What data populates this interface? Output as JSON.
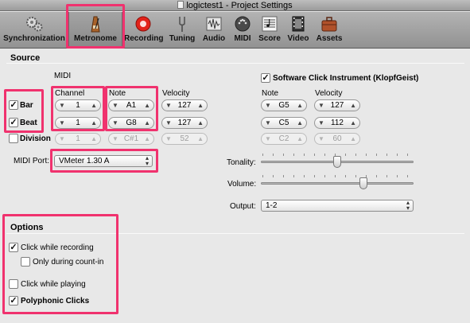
{
  "window": {
    "title": "logictest1 - Project Settings"
  },
  "toolbar": {
    "items": [
      {
        "label": "Synchronization",
        "icon": "gears-icon"
      },
      {
        "label": "Metronome",
        "icon": "metronome-icon",
        "selected": true
      },
      {
        "label": "Recording",
        "icon": "record-icon"
      },
      {
        "label": "Tuning",
        "icon": "tuning-fork-icon"
      },
      {
        "label": "Audio",
        "icon": "audio-icon"
      },
      {
        "label": "MIDI",
        "icon": "midi-icon"
      },
      {
        "label": "Score",
        "icon": "score-icon"
      },
      {
        "label": "Video",
        "icon": "video-icon"
      },
      {
        "label": "Assets",
        "icon": "assets-icon"
      }
    ]
  },
  "source": {
    "title": "Source",
    "midi_heading": "MIDI",
    "headers": {
      "channel": "Channel",
      "note": "Note",
      "velocity": "Velocity"
    },
    "rows": [
      {
        "label": "Bar",
        "checked": true,
        "channel": "1",
        "note": "A1",
        "velocity": "127",
        "sw_note": "G5",
        "sw_velocity": "127"
      },
      {
        "label": "Beat",
        "checked": true,
        "channel": "1",
        "note": "G8",
        "velocity": "127",
        "sw_note": "C5",
        "sw_velocity": "112"
      },
      {
        "label": "Division",
        "checked": false,
        "channel": "1",
        "note": "C#1",
        "velocity": "52",
        "sw_note": "C2",
        "sw_velocity": "60"
      }
    ],
    "midi_port_label": "MIDI Port:",
    "midi_port_value": "VMeter 1.30 A",
    "software_click": {
      "label": "Software Click Instrument (KlopfGeist)",
      "checked": true
    },
    "sw_headers": {
      "note": "Note",
      "velocity": "Velocity"
    },
    "tonality_label": "Tonality:",
    "tonality_value": 0.5,
    "volume_label": "Volume:",
    "volume_value": 0.68,
    "output_label": "Output:",
    "output_value": "1-2"
  },
  "options": {
    "title": "Options",
    "click_while_recording": {
      "label": "Click while recording",
      "checked": true
    },
    "only_during_count_in": {
      "label": "Only during count-in",
      "checked": false
    },
    "click_while_playing": {
      "label": "Click while playing",
      "checked": false
    },
    "polyphonic_clicks": {
      "label": "Polyphonic Clicks",
      "checked": true
    }
  },
  "colors": {
    "highlight": "#f0326e",
    "record": "#e2231a"
  }
}
